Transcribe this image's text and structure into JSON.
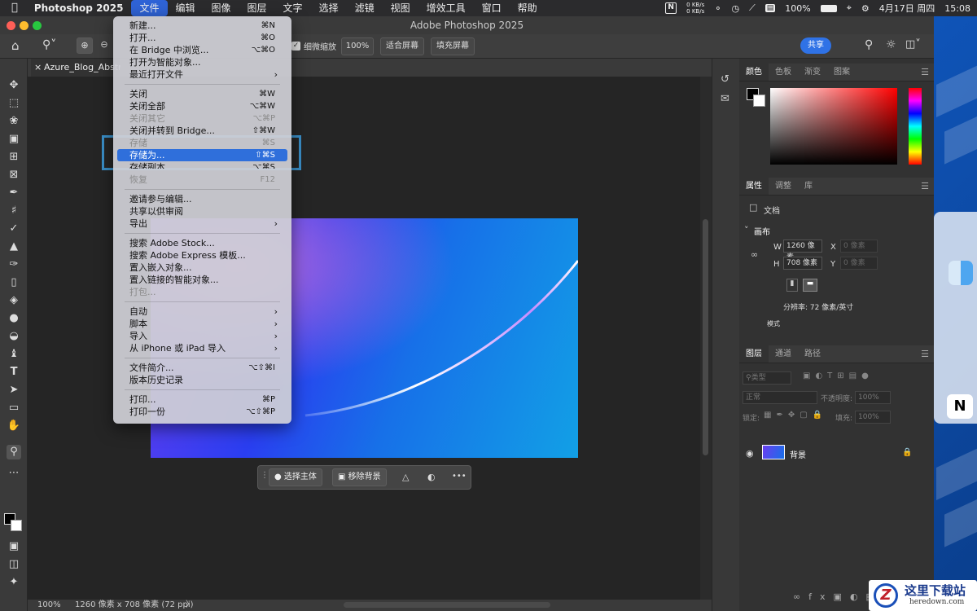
{
  "menubar": {
    "app_name": "Photoshop 2025",
    "items": [
      "文件",
      "编辑",
      "图像",
      "图层",
      "文字",
      "选择",
      "滤镜",
      "视图",
      "增效工具",
      "窗口",
      "帮助"
    ],
    "net_up": "0 KB/s",
    "net_down": "0 KB/s",
    "battery": "100%",
    "date": "4月17日 周四",
    "time": "15:08",
    "notion_letter": "N"
  },
  "window": {
    "title": "Adobe Photoshop 2025"
  },
  "options": {
    "scrubby_zoom": "细微缩放",
    "zoom_value": "100%",
    "fit_screen": "适合屏幕",
    "fill_screen": "填充屏幕",
    "share": "共享"
  },
  "document": {
    "tab": "Azure_Blog_Abstr"
  },
  "status": {
    "zoom": "100%",
    "info": "1260 像素 x 708 像素 (72 ppi)",
    "arrow": "〉"
  },
  "contextual": {
    "select_subject": "选择主体",
    "remove_bg": "移除背景",
    "more": "•••"
  },
  "file_menu": [
    {
      "label": "新建...",
      "key": "⌘N"
    },
    {
      "label": "打开...",
      "key": "⌘O"
    },
    {
      "label": "在 Bridge 中浏览...",
      "key": "⌥⌘O"
    },
    {
      "label": "打开为智能对象...",
      "key": ""
    },
    {
      "label": "最近打开文件",
      "key": "",
      "submenu": true
    },
    {
      "label": "关闭",
      "key": "⌘W"
    },
    {
      "label": "关闭全部",
      "key": "⌥⌘W"
    },
    {
      "label": "关闭其它",
      "key": "⌥⌘P",
      "disabled": true
    },
    {
      "label": "关闭并转到 Bridge...",
      "key": "⇧⌘W"
    },
    {
      "label": "存储",
      "key": "⌘S",
      "disabled": true
    },
    {
      "label": "存储为...",
      "key": "⇧⌘S",
      "highlighted": true
    },
    {
      "label": "存储副本...",
      "key": "⌥⌘S"
    },
    {
      "label": "恢复",
      "key": "F12",
      "disabled": true
    },
    {
      "label": "邀请参与编辑...",
      "key": ""
    },
    {
      "label": "共享以供审阅",
      "key": ""
    },
    {
      "label": "导出",
      "key": "",
      "submenu": true
    },
    {
      "label": "搜索 Adobe Stock...",
      "key": ""
    },
    {
      "label": "搜索 Adobe Express 模板...",
      "key": ""
    },
    {
      "label": "置入嵌入对象...",
      "key": ""
    },
    {
      "label": "置入链接的智能对象...",
      "key": ""
    },
    {
      "label": "打包...",
      "key": "",
      "disabled": true
    },
    {
      "label": "自动",
      "key": "",
      "submenu": true
    },
    {
      "label": "脚本",
      "key": "",
      "submenu": true
    },
    {
      "label": "导入",
      "key": "",
      "submenu": true
    },
    {
      "label": "从 iPhone 或 iPad 导入",
      "key": "",
      "submenu": true
    },
    {
      "label": "文件简介...",
      "key": "⌥⇧⌘I"
    },
    {
      "label": "版本历史记录",
      "key": ""
    },
    {
      "label": "打印...",
      "key": "⌘P"
    },
    {
      "label": "打印一份",
      "key": "⌥⇧⌘P"
    }
  ],
  "color_panel": {
    "tabs": [
      "颜色",
      "色板",
      "渐变",
      "图案"
    ]
  },
  "properties_panel": {
    "tabs": [
      "属性",
      "调整",
      "库"
    ],
    "doc_label": "文档",
    "canvas_label": "画布",
    "w_label": "W",
    "w_value": "1260 像素",
    "h_label": "H",
    "h_value": "708 像素",
    "x_label": "X",
    "x_placeholder": "0 像素",
    "y_label": "Y",
    "y_placeholder": "0 像素",
    "resolution": "分辨率: 72 像素/英寸",
    "mode_label": "模式"
  },
  "layers_panel": {
    "tabs": [
      "图层",
      "通道",
      "路径"
    ],
    "filter_kind": "类型",
    "blend_mode": "正常",
    "opacity_label": "不透明度:",
    "opacity_value": "100%",
    "lock_label": "锁定:",
    "fill_label": "填充:",
    "fill_value": "100%",
    "layer_name": "背景"
  },
  "watermark": {
    "text": "这里下载站",
    "url": "heredown.com",
    "letter": "Z"
  },
  "colors": {
    "accent": "#2f6fdb",
    "share": "#2f72e6",
    "highlight_box": "#3a8fc8"
  }
}
